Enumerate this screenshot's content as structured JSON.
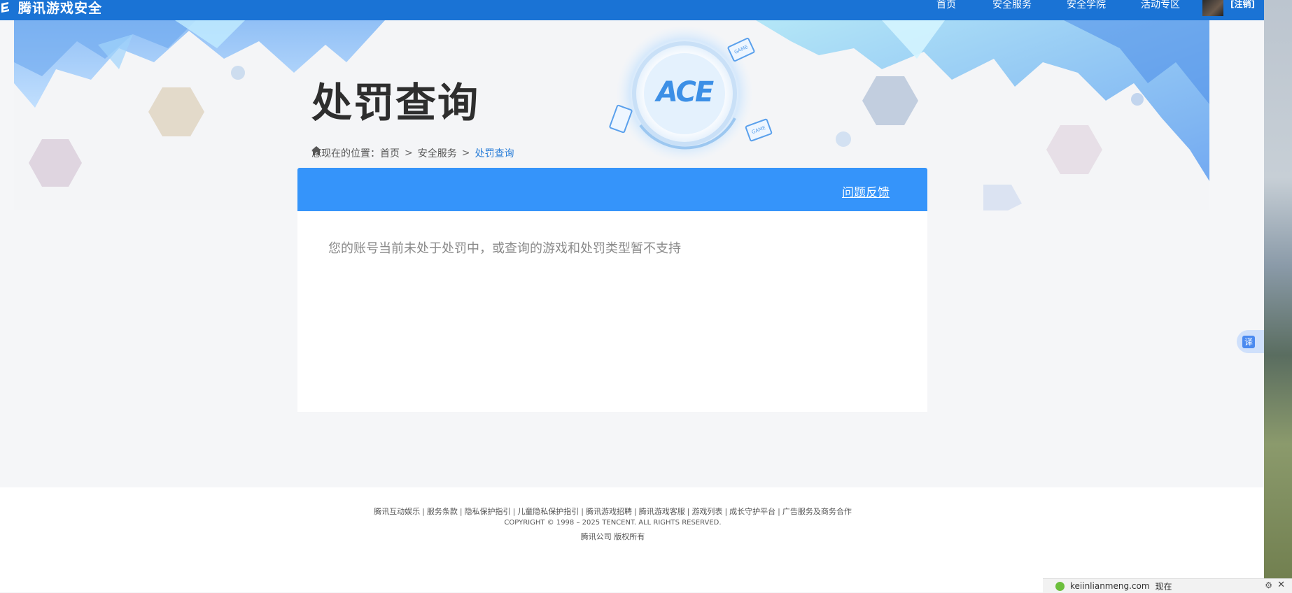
{
  "header": {
    "logo_text": "腾讯游戏安全",
    "nav": [
      "首页",
      "安全服务",
      "安全学院",
      "活动专区"
    ],
    "register": "[注销]"
  },
  "hero": {
    "title": "处罚查询",
    "breadcrumb": {
      "prefix": "您现在的位置：",
      "items": [
        "首页",
        "安全服务"
      ],
      "current": "处罚查询",
      "separator": ">"
    },
    "badge_text": "ACE",
    "game_tag": "GAME"
  },
  "panel": {
    "feedback": "问题反馈",
    "message": "您的账号当前未处于处罚中，或查询的游戏和处罚类型暂不支持"
  },
  "footer": {
    "links": [
      "腾讯互动娱乐",
      "服务条款",
      "隐私保护指引",
      "儿童隐私保护指引",
      "腾讯游戏招聘",
      "腾讯游戏客服",
      "游戏列表",
      "成长守护平台",
      "广告服务及商务合作"
    ],
    "copyright": "COPYRIGHT © 1998 – 2025 TENCENT. ALL RIGHTS RESERVED.",
    "company": "腾讯公司 版权所有"
  },
  "widgets": {
    "translate": "译",
    "notify_text": "keiinlianmeng.com",
    "notify_time": "现在"
  },
  "colors": {
    "topbar": "#1a73d5",
    "panel_header": "#3594fa",
    "breadcrumb_current": "#2a7ed8"
  }
}
